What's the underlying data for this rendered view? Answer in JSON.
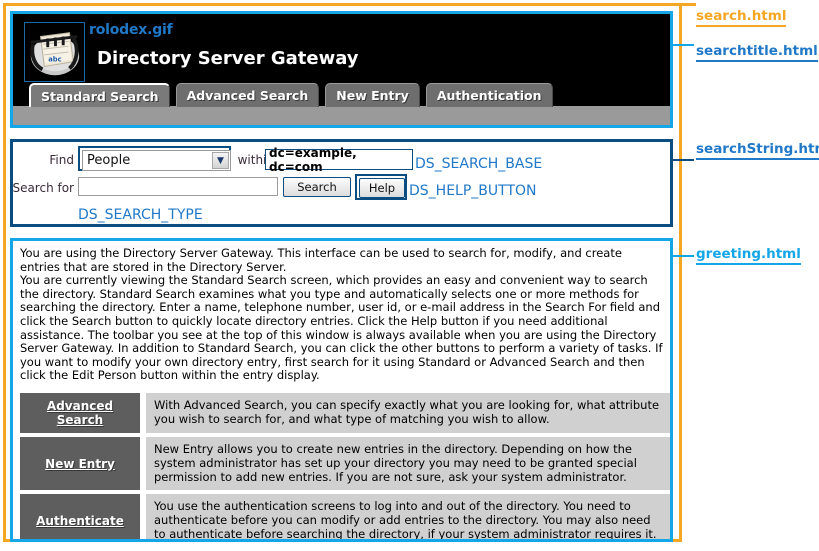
{
  "page": {
    "frame_color": "#F5A623",
    "header_border_color": "#15A6E8",
    "search_border_color": "#0B4D80",
    "greeting_border_color": "#15A6E8"
  },
  "header": {
    "logo_caption": "rolodex.gif",
    "logo_icon": "rolodex-card-file-icon",
    "title": "Directory Server Gateway",
    "tabs": [
      {
        "label": "Standard Search",
        "active": true
      },
      {
        "label": "Advanced Search",
        "active": false
      },
      {
        "label": "New Entry",
        "active": false
      },
      {
        "label": "Authentication",
        "active": false
      }
    ]
  },
  "search_form": {
    "find_label": "Find",
    "find_selected": "People",
    "find_options": [
      "People"
    ],
    "within_label": "within",
    "search_base_value": "dc=example, dc=com",
    "search_for_label": "Search for",
    "search_for_value": "",
    "search_for_placeholder": "",
    "search_button_label": "Search",
    "help_button_label": "Help",
    "callouts": {
      "search_base": "DS_SEARCH_BASE",
      "help_button": "DS_HELP_BUTTON",
      "search_type": "DS_SEARCH_TYPE"
    }
  },
  "greeting": {
    "paragraph1": "You are using the Directory Server Gateway. This interface can be used to search for, modify, and create entries that are stored in the Directory Server.",
    "paragraph2": "You are currently viewing the Standard Search screen, which provides an easy and convenient way to search the directory. Standard Search examines what you type and automatically selects one or more methods for searching the directory. Enter a name, telephone number, user id, or e-mail address in the Search For field and click the Search button to quickly locate directory entries. Click the Help button if you need additional assistance. The toolbar you see at the top of this window is always available when you are using the Directory Server Gateway. In addition to Standard Search, you can click the other buttons to perform a variety of tasks. If you want to modify your own directory entry, first search for it using Standard or Advanced Search and then click the Edit Person button within the entry display.",
    "rows": [
      {
        "button": "Advanced Search",
        "description": "With Advanced Search, you can specify exactly what you are looking for, what attribute you wish to search for, and what type of matching you wish to allow."
      },
      {
        "button": "New Entry",
        "description": "New Entry allows you to create new entries in the directory. Depending on how the system administrator has set up your directory you may need to be granted special permission to add new entries. If you are not sure, ask your system administrator."
      },
      {
        "button": "Authenticate",
        "description": "You use the authentication screens to log into and out of the directory. You need to authenticate before you can modify or add entries to the directory. You may also need to authenticate before searching the directory, if your system administrator requires it."
      }
    ]
  },
  "annotations": {
    "search": "search.html",
    "searchtitle": "searchtitle.html",
    "searchstring": "searchString.html",
    "greeting": "greeting.html"
  }
}
